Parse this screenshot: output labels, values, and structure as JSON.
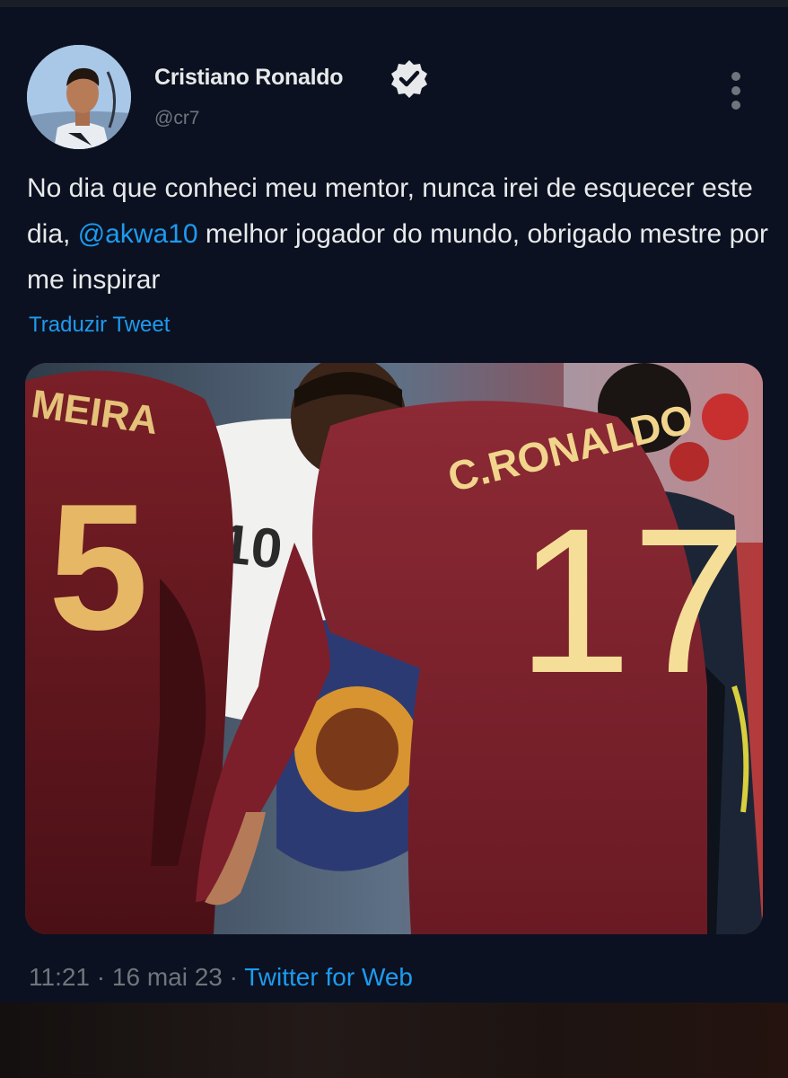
{
  "author": {
    "name": "Cristiano Ronaldo",
    "handle": "@cr7",
    "verified_icon": "verified-badge-icon"
  },
  "tweet": {
    "text_part1": "No dia que conheci meu mentor, nunca irei de esquecer este dia, ",
    "mention": "@akwa10",
    "text_part2": " melhor jogador do mundo, obrigado mestre por me inspirar",
    "translate_label": "Traduzir Tweet"
  },
  "media": {
    "jersey_left_name": "MEIRA",
    "jersey_left_number": "5",
    "jersey_center_number": "10",
    "jersey_right_name": "C.RONALDO",
    "jersey_right_number": "17"
  },
  "meta": {
    "time": "11:21",
    "date": "16 mai 23",
    "source": "Twitter for Web",
    "separator": "·"
  },
  "colors": {
    "background": "#0b1120",
    "link": "#1d9bf0",
    "secondary_text": "#6e767d",
    "primary_text": "#e7e9ea"
  }
}
